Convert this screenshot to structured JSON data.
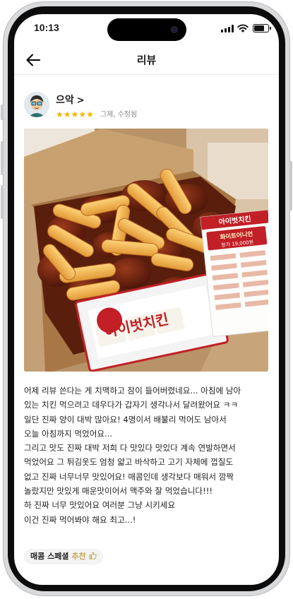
{
  "status_bar": {
    "time": "10:13",
    "battery_level": 0.8
  },
  "header": {
    "title": "리뷰",
    "back_icon": "arrow-left-icon"
  },
  "review": {
    "reviewer_name": "으악",
    "name_chevron": ">",
    "rating": 5,
    "stars": [
      "★",
      "★",
      "★",
      "★",
      "★"
    ],
    "edited_label": "그제, 수정됨",
    "photo_texts": {
      "box_brand": "아이벗치킨",
      "flyer_brand": "아이벗치킨",
      "flyer_menu": "화이트어니언",
      "flyer_price": "정가 19,000원"
    },
    "body_lines": [
      "어제 리뷰 쓴다는 게 치맥하고 잠이 들어버렸네요... 아침에 남아",
      "있는 치킨 먹으려고 데우다가 갑자기 생각나서 달려왔어요 ㅋㅋ",
      "일단 진짜 양이 대박 많아요! 4명이서 배불리 먹어도 남아서",
      "오늘 아침까지 먹었어요...",
      "그리고 맛도 진짜 대박 저희 다 맛있다 맛있다 계속 연발하면서",
      "먹었어요 그 튀김옷도 엄청 얇고 바삭하고 고기 자체에 껍질도",
      "없고 진짜 너무너무 맛있어요! 매콤인데 생각보다 매워서 깜짝",
      "놀랐지만 맛있게 매운맛이어서 맥주와 잘 먹었습니다!!!",
      "하 진짜 너무 맛있어요 여러분 그냥 시키세요",
      "이건 진짜 먹어봐야 해요 최고...!"
    ],
    "tag": {
      "menu": "매콤 스페셜",
      "recommend": "추천",
      "icon": "thumbs-up-icon"
    }
  }
}
